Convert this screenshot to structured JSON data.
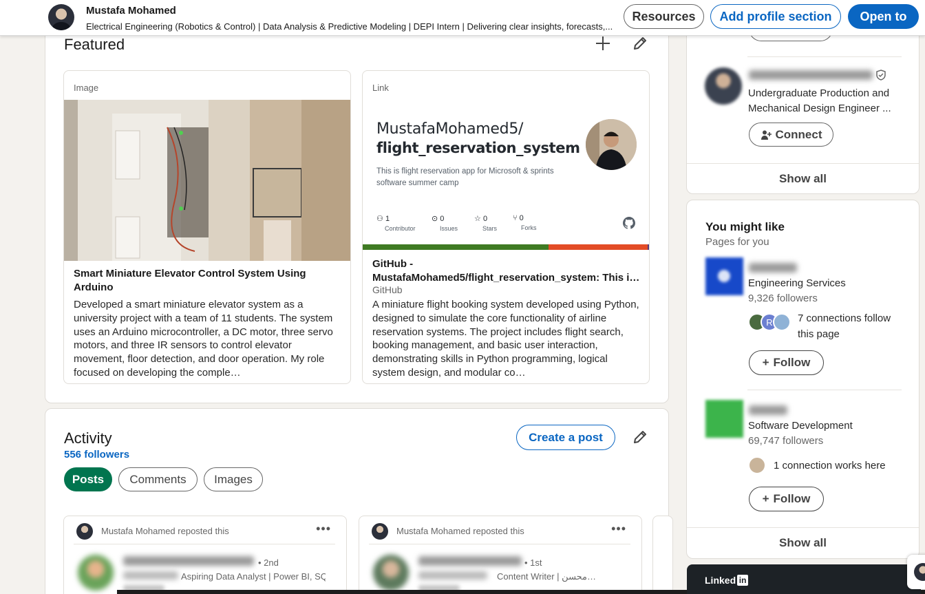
{
  "topbar": {
    "name": "Mustafa Mohamed",
    "headline": "Electrical Engineering (Robotics & Control) | Data Analysis & Predictive Modeling | DEPI Intern | Delivering clear insights, forecasts,...",
    "resources_label": "Resources",
    "add_section_label": "Add profile section",
    "open_to_label": "Open to"
  },
  "featured": {
    "title": "Featured",
    "items": [
      {
        "type": "Image",
        "title": "Smart Miniature Elevator Control System Using Arduino",
        "description": "Developed a smart miniature elevator system as a university project with a team of 11 students. The system uses an Arduino microcontroller, a DC motor, three servo motors, and three IR sensors to control elevator movement, floor detection, and door operation. My role focused on developing the comple…"
      },
      {
        "type": "Link",
        "preview": {
          "owner": "MustafaMohamed5/",
          "repo": "flight_reservation_system",
          "desc": "This is flight reservation app for Microsoft & sprints software summer camp",
          "stats": [
            {
              "icon": "contributors-icon",
              "value": "1",
              "label": "Contributor"
            },
            {
              "icon": "issues-icon",
              "value": "0",
              "label": "Issues"
            },
            {
              "icon": "stars-icon",
              "value": "0",
              "label": "Stars"
            },
            {
              "icon": "forks-icon",
              "value": "0",
              "label": "Forks"
            }
          ],
          "bar_colors": [
            "#3f7b23",
            "#e34c26",
            "#563d7c"
          ]
        },
        "title": "GitHub - MustafaMohamed5/flight_reservation_system: This i…",
        "source": "GitHub",
        "description": "A miniature flight booking system developed using Python, designed to simulate the core functionality of airline reservation systems. The project includes flight search, booking management, and basic user interaction, demonstrating skills in Python programming, logical system design, and modular co…"
      }
    ]
  },
  "activity": {
    "title": "Activity",
    "followers": "556 followers",
    "create_post_label": "Create a post",
    "tabs": [
      "Posts",
      "Comments",
      "Images"
    ],
    "posts": [
      {
        "repost_text": "Mustafa Mohamed reposted this",
        "degree": "• 2nd",
        "sub": "Aspiring Data Analyst | Power BI, SQL & Pytho…"
      },
      {
        "repost_text": "Mustafa Mohamed reposted this",
        "degree": "• 1st",
        "sub": "Content Writer | محسن…"
      }
    ]
  },
  "sidebar": {
    "person": {
      "headline": "Undergraduate Production and Mechanical Design Engineer ...",
      "connect_label": "Connect"
    },
    "show_all_label": "Show all",
    "you_might_like": {
      "title": "You might like",
      "subtitle": "Pages for you",
      "pages": [
        {
          "industry": "Engineering Services",
          "followers": "9,326 followers",
          "connections": "7 connections follow this page",
          "follow_label": "Follow",
          "avatar_initial": "R"
        },
        {
          "industry": "Software Development",
          "followers": "69,747 followers",
          "connections": "1 connection works here",
          "follow_label": "Follow"
        }
      ]
    },
    "linkedin_word": "Linked",
    "linkedin_box": "in"
  },
  "colors": {
    "brand": "#0a66c2",
    "active_chip": "#01754f"
  }
}
